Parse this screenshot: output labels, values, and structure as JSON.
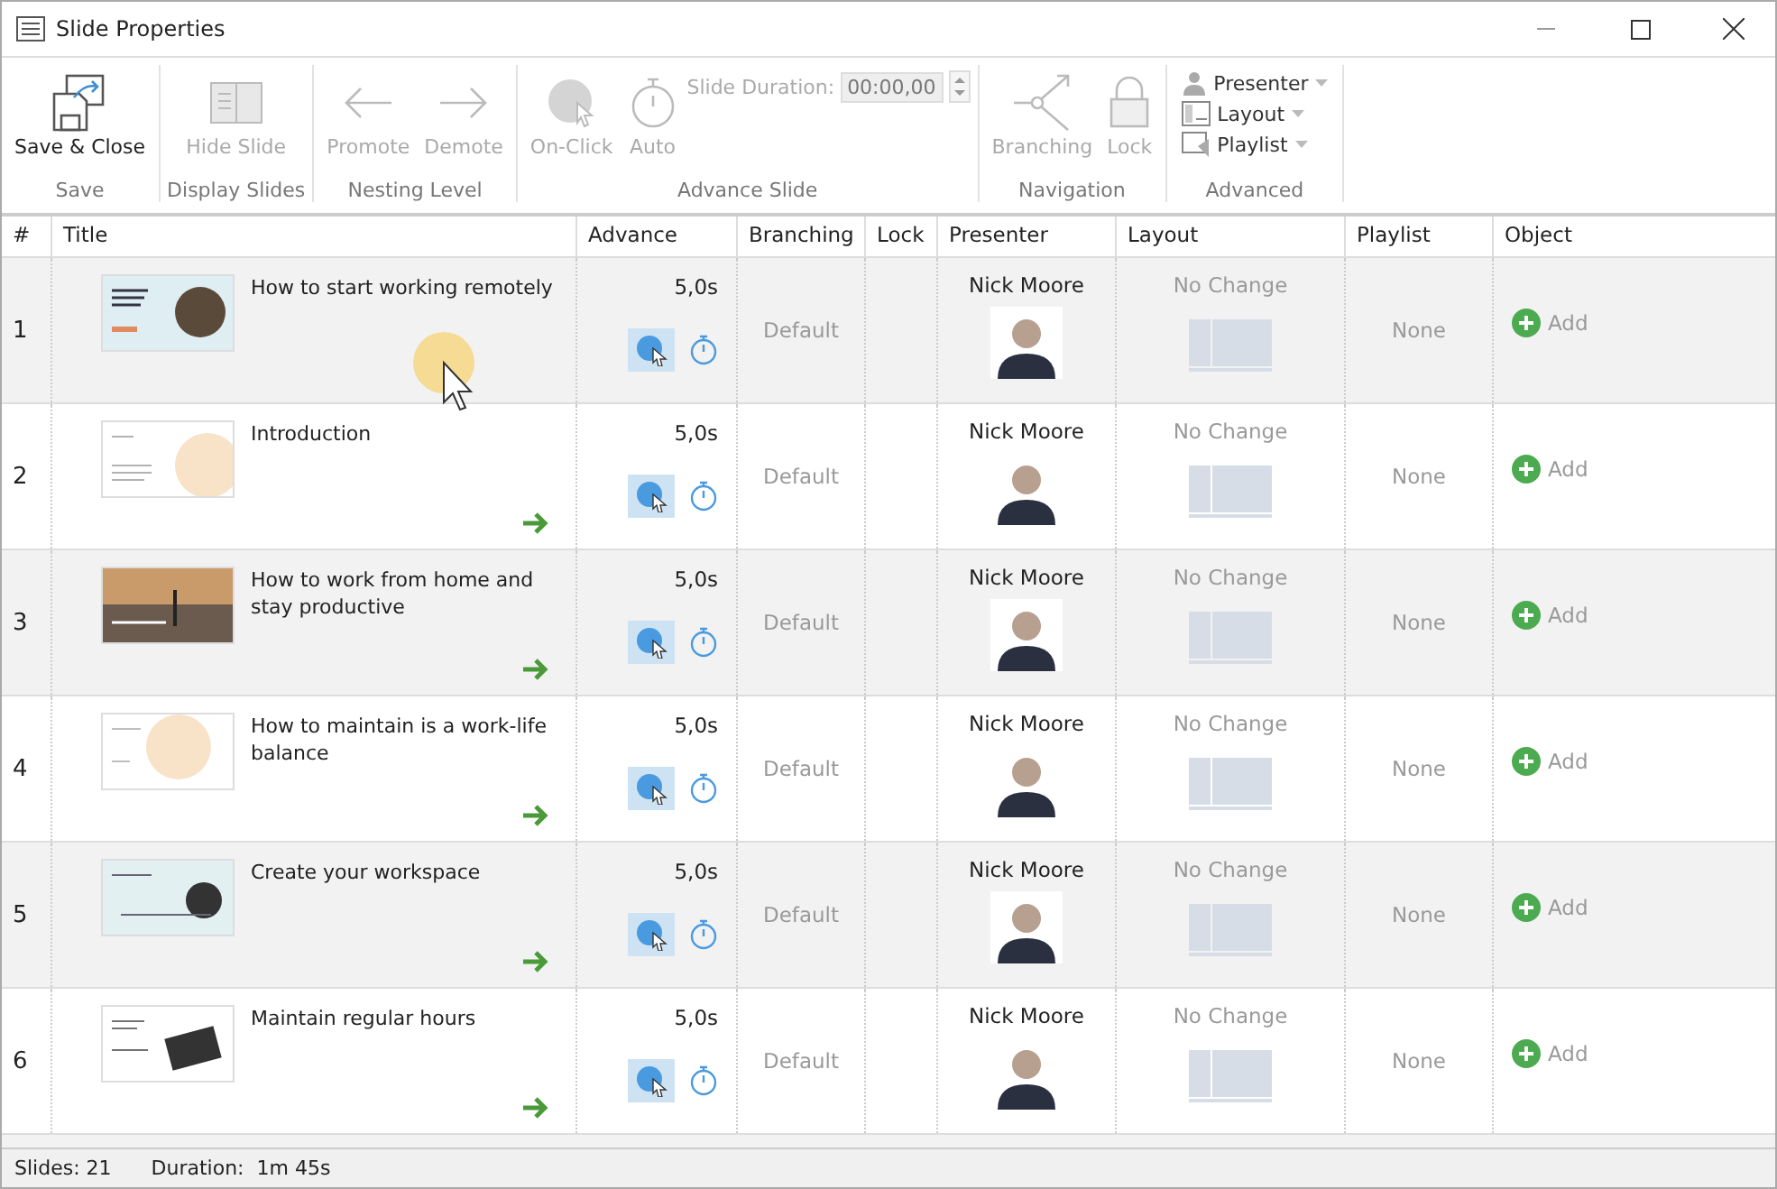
{
  "window": {
    "title": "Slide Properties"
  },
  "ribbon": {
    "groups": [
      {
        "label": "Save",
        "buttons": [
          {
            "kind": "save",
            "label": "Save & Close",
            "disabled": false
          }
        ]
      },
      {
        "label": "Display Slides",
        "buttons": [
          {
            "kind": "hide",
            "label": "Hide Slide",
            "disabled": true
          }
        ]
      },
      {
        "label": "Nesting Level",
        "buttons": [
          {
            "kind": "promote",
            "label": "Promote",
            "disabled": true
          },
          {
            "kind": "demote",
            "label": "Demote",
            "disabled": true
          }
        ]
      },
      {
        "label": "Advance Slide",
        "buttons": [
          {
            "kind": "onclick",
            "label": "On-Click",
            "disabled": true
          },
          {
            "kind": "auto",
            "label": "Auto",
            "disabled": true
          }
        ],
        "duration": {
          "label": "Slide Duration:",
          "value": "00:00,00"
        }
      },
      {
        "label": "Navigation",
        "buttons": [
          {
            "kind": "branching",
            "label": "Branching",
            "disabled": true
          },
          {
            "kind": "lock",
            "label": "Lock",
            "disabled": true
          }
        ]
      },
      {
        "label": "Advanced",
        "menus": [
          {
            "kind": "presenter",
            "label": "Presenter"
          },
          {
            "kind": "layout",
            "label": "Layout"
          },
          {
            "kind": "playlist",
            "label": "Playlist"
          }
        ]
      }
    ]
  },
  "table": {
    "columns": [
      "#",
      "Title",
      "Advance",
      "Branching",
      "Lock",
      "Presenter",
      "Layout",
      "Playlist",
      "Object"
    ],
    "rows": [
      {
        "number": "1",
        "title": "How to start working remotely",
        "duration": "5,0s",
        "on_click": true,
        "auto": false,
        "demote_arrow": false,
        "branching": "Default",
        "presenter": "Nick Moore",
        "layout": "No Change",
        "playlist": "None",
        "object": "Add"
      },
      {
        "number": "2",
        "title": "Introduction",
        "duration": "5,0s",
        "on_click": true,
        "auto": false,
        "demote_arrow": true,
        "branching": "Default",
        "presenter": "Nick Moore",
        "layout": "No Change",
        "playlist": "None",
        "object": "Add"
      },
      {
        "number": "3",
        "title": "How to work from home and stay productive",
        "duration": "5,0s",
        "on_click": true,
        "auto": false,
        "demote_arrow": true,
        "branching": "Default",
        "presenter": "Nick Moore",
        "layout": "No Change",
        "playlist": "None",
        "object": "Add"
      },
      {
        "number": "4",
        "title": "How to maintain is a work-life balance",
        "duration": "5,0s",
        "on_click": true,
        "auto": false,
        "demote_arrow": true,
        "branching": "Default",
        "presenter": "Nick Moore",
        "layout": "No Change",
        "playlist": "None",
        "object": "Add"
      },
      {
        "number": "5",
        "title": "Create your workspace",
        "duration": "5,0s",
        "on_click": true,
        "auto": false,
        "demote_arrow": true,
        "branching": "Default",
        "presenter": "Nick Moore",
        "layout": "No Change",
        "playlist": "None",
        "object": "Add"
      },
      {
        "number": "6",
        "title": "Maintain regular hours",
        "duration": "5,0s",
        "on_click": true,
        "auto": false,
        "demote_arrow": true,
        "branching": "Default",
        "presenter": "Nick Moore",
        "layout": "No Change",
        "playlist": "None",
        "object": "Add"
      }
    ]
  },
  "status_bar": {
    "slides": "Slides: 21",
    "duration": "Duration:  1m 45s"
  }
}
